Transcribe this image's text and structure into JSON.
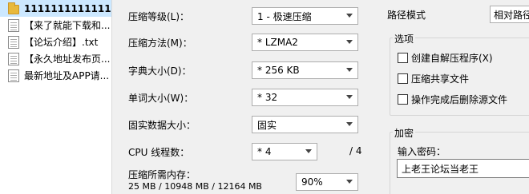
{
  "files": [
    {
      "name": "1111111111111111...",
      "type": "folder",
      "selected": true
    },
    {
      "name": "【来了就能下载和...",
      "type": "doc"
    },
    {
      "name": "【论坛介绍】.txt",
      "type": "doc"
    },
    {
      "name": "【永久地址发布页...",
      "type": "doc"
    },
    {
      "name": "最新地址及APP请...",
      "type": "doc"
    }
  ],
  "settings": {
    "level_label": "压缩等级(L)：",
    "level_value": "1 - 极速压缩",
    "method_label": "压缩方法(M)：",
    "method_value": "* LZMA2",
    "dict_label": "字典大小(D)：",
    "dict_value": "* 256 KB",
    "word_label": "单词大小(W)：",
    "word_value": "* 32",
    "solid_label": "固实数据大小：",
    "solid_value": "固实",
    "cpu_label": "CPU 线程数：",
    "cpu_value": "* 4",
    "cpu_total": "/ 4",
    "mem_label": "压缩所需内存：",
    "mem_value": "25 MB / 10948 MB / 12164 MB",
    "mem_percent": "90%"
  },
  "path_mode": {
    "label": "路径模式",
    "value": "相对路径"
  },
  "options": {
    "title": "选项",
    "sfx": "创建自解压程序(X)",
    "shared": "压缩共享文件",
    "delete_after": "操作完成后删除源文件"
  },
  "encryption": {
    "title": "加密",
    "password_label": "输入密码：",
    "password_value": "上老王论坛当老王"
  }
}
